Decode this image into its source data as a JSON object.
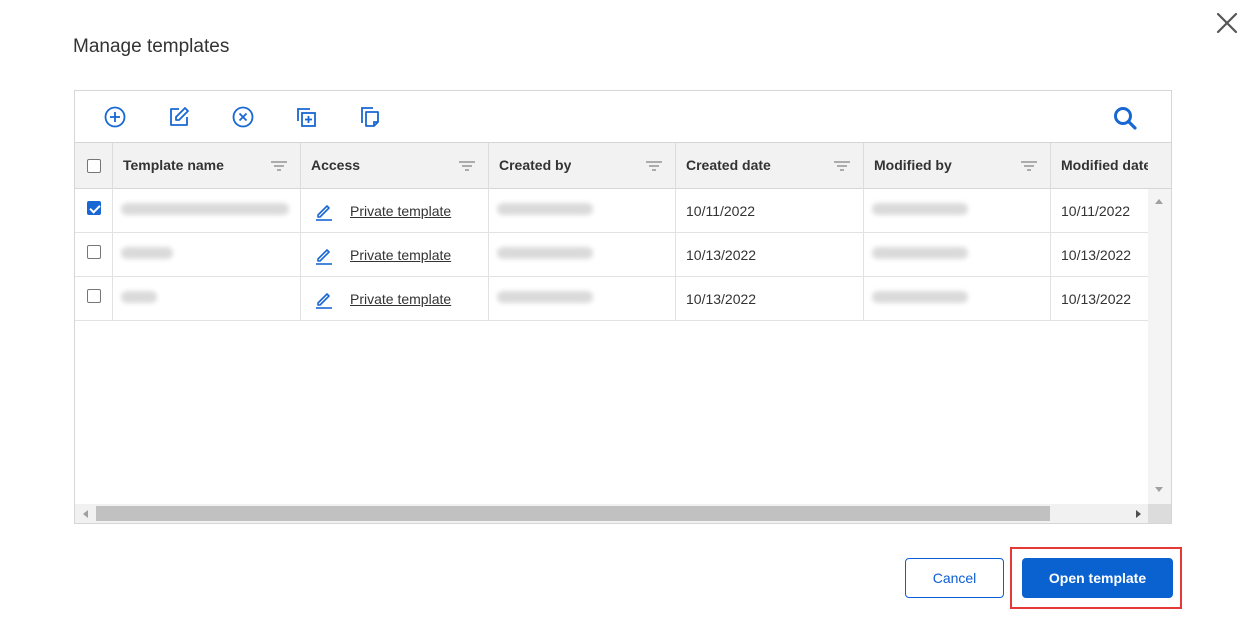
{
  "dialog": {
    "title": "Manage templates"
  },
  "toolbar": {
    "icons": [
      "add-icon",
      "edit-icon",
      "delete-icon",
      "duplicate-icon",
      "copy-icon",
      "search-icon"
    ]
  },
  "table": {
    "columns": [
      "Template name",
      "Access",
      "Created by",
      "Created date",
      "Modified by",
      "Modified date"
    ],
    "rows": [
      {
        "checked": true,
        "access": "Private template",
        "created_date": "10/11/2022",
        "modified_date": "10/11/2022"
      },
      {
        "checked": false,
        "access": "Private template",
        "created_date": "10/13/2022",
        "modified_date": "10/13/2022"
      },
      {
        "checked": false,
        "access": "Private template",
        "created_date": "10/13/2022",
        "modified_date": "10/13/2022"
      }
    ]
  },
  "footer": {
    "cancel_label": "Cancel",
    "open_label": "Open template"
  },
  "colors": {
    "accent": "#0a62d0",
    "highlight_border": "#e53935"
  }
}
